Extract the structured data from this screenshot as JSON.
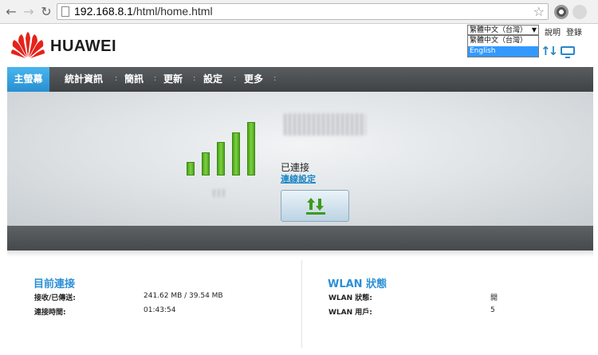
{
  "browser": {
    "url_host": "192.168.8.1",
    "url_path": "/html/home.html"
  },
  "header": {
    "brand": "HUAWEI",
    "language": {
      "selected": "繁體中文（台灣）",
      "options": [
        "繁體中文（台灣）",
        "English"
      ],
      "highlighted": "English"
    },
    "help_link": "說明",
    "login_link": "登錄"
  },
  "nav": {
    "items": [
      "主螢幕",
      "統計資訊",
      "簡訊",
      "更新",
      "設定",
      "更多"
    ]
  },
  "status": {
    "signal_level": 5,
    "signal_max": 5,
    "connection_status": "已連接",
    "connection_settings_link": "連線設定"
  },
  "current_connection": {
    "title": "目前連接",
    "rows": [
      {
        "label": "接收/已傳送:",
        "value": "241.62 MB /  39.54 MB"
      },
      {
        "label": "連接時間:",
        "value": "01:43:54"
      }
    ]
  },
  "wlan": {
    "title": "WLAN 狀態",
    "rows": [
      {
        "label": "WLAN 狀態:",
        "value": "開"
      },
      {
        "label": "WLAN 用戶:",
        "value": "5"
      }
    ]
  },
  "colors": {
    "accent": "#2c8fd6",
    "signal_green": "#5bb829",
    "nav_active": "#2a8fd0"
  }
}
